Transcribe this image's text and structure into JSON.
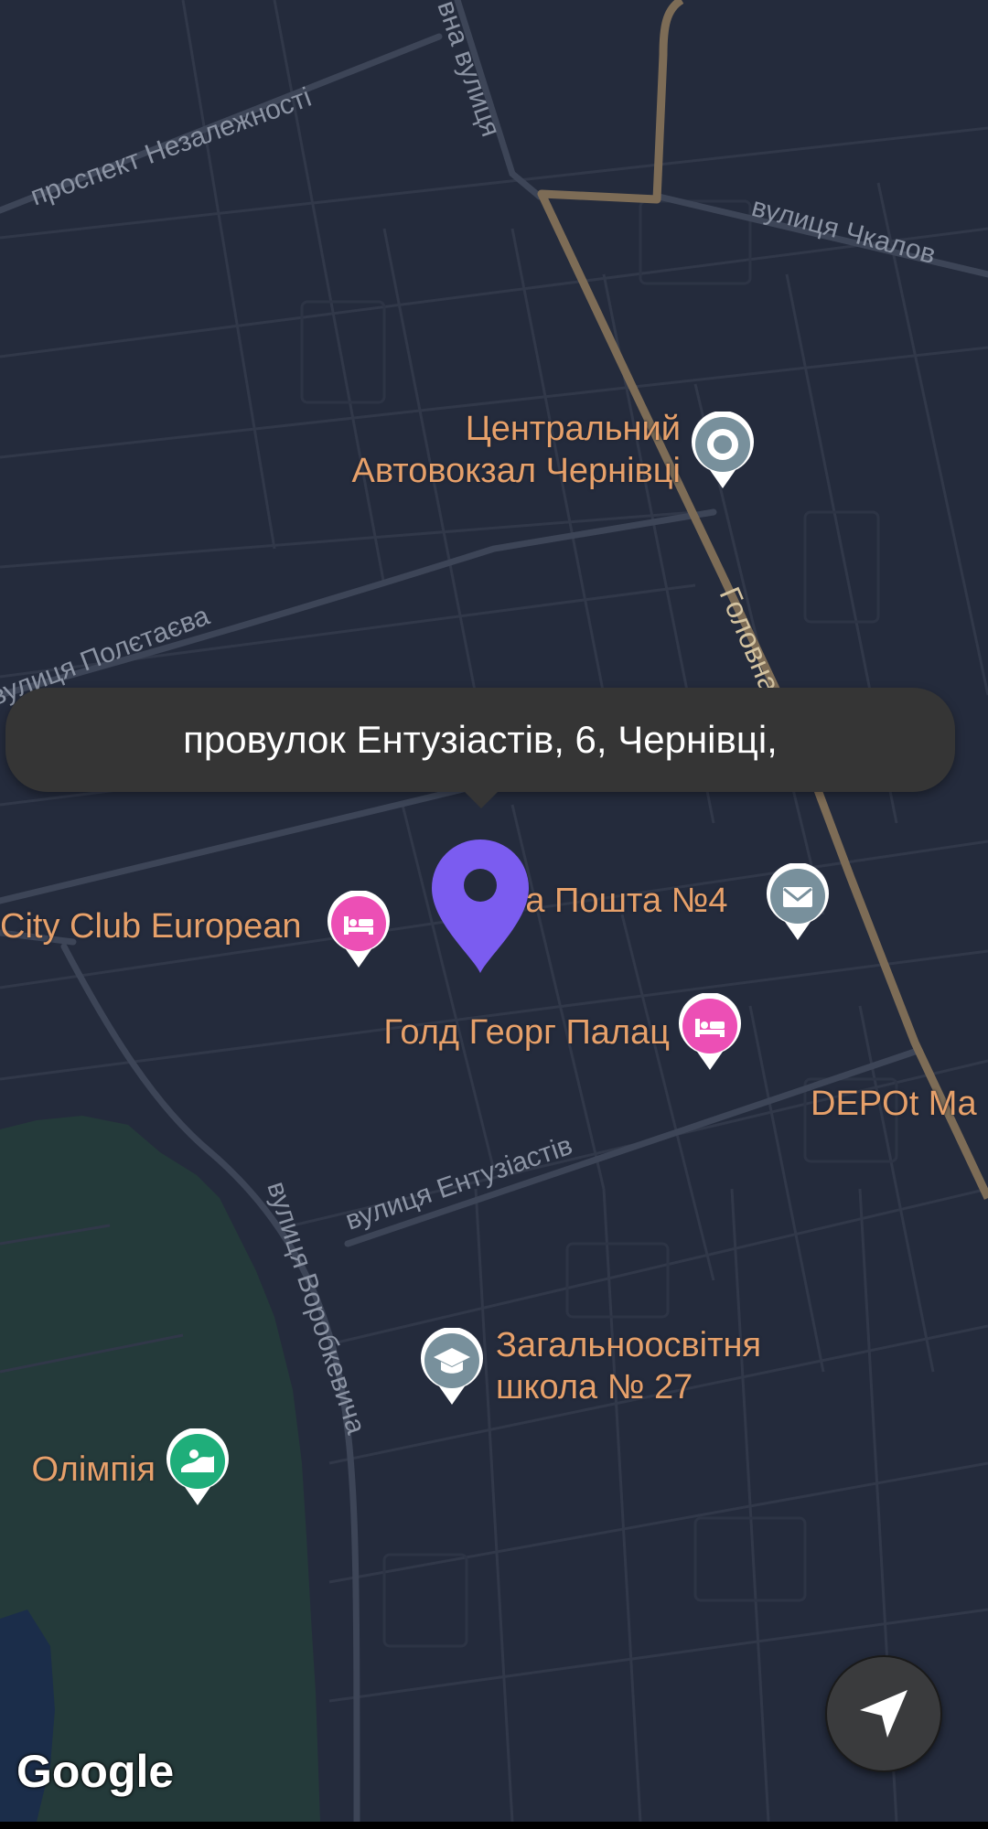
{
  "map": {
    "attribution": "Google",
    "streets": {
      "prospekt_nezalezhnosti": "проспект Незалежності",
      "vna_vulytsia": "вна вулиця",
      "vulytsia_chkalova": "вулиця Чкалов",
      "vulytsia_poletaieva": "вулиця Полєтаєва",
      "holovna": "Головна вулиця",
      "vulytsia_entuziastiv": "вулиця Ентузіастів",
      "vulytsia_vorobkevycha": "вулиця Воробкевича"
    },
    "pois": [
      {
        "label_line1": "Центральний",
        "label_line2": "Автовокзал Чернівці",
        "icon": "transit-station-icon",
        "icon_color": "#78909c"
      },
      {
        "label_line1": "City Club European",
        "label_line2": "",
        "icon": "hotel-bed-icon",
        "icon_color": "#ec4fb5"
      },
      {
        "label_line1": "Нова Пошта №4",
        "label_line2": "",
        "icon": "mail-envelope-icon",
        "icon_color": "#78909c"
      },
      {
        "label_line1": "Голд Георг Палац",
        "label_line2": "",
        "icon": "hotel-bed-icon",
        "icon_color": "#ec4fb5"
      },
      {
        "label_line1": "DEPOt Ma",
        "label_line2": "",
        "icon": "",
        "icon_color": ""
      },
      {
        "label_line1": "Загальноосвітня",
        "label_line2": "школа № 27",
        "icon": "school-graduation-cap-icon",
        "icon_color": "#78909c"
      },
      {
        "label_line1": "Олімпія",
        "label_line2": "",
        "icon": "park-amusement-icon",
        "icon_color": "#1fae7a"
      }
    ],
    "selected_address": "провулок Ентузіастів, 6, Чернівці,",
    "marker_color": "#7b5cf0",
    "locate_button": "navigation-arrow-icon"
  }
}
